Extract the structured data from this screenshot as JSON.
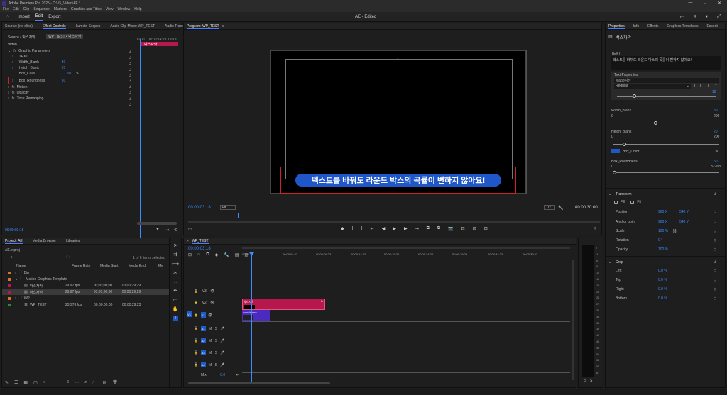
{
  "app": {
    "title": "Adobe Premiere Pro 2025 - D:\\15_Video\\AE *",
    "window_buttons": [
      "—",
      "□",
      "✕"
    ]
  },
  "menu": [
    "File",
    "Edit",
    "Clip",
    "Sequence",
    "Markers",
    "Graphics and Titles",
    "View",
    "Window",
    "Help"
  ],
  "workspace": {
    "tabs": [
      "Import",
      "Edit",
      "Export"
    ],
    "active": "Edit",
    "center_text": "AE - Edited"
  },
  "effect_controls": {
    "tabs": [
      "Source: (no clips)",
      "Effect Controls",
      "Lumetri Scopes",
      "Audio Clip Mixer: WP_TEST",
      "Audio Track Mix"
    ],
    "source_label": "Source • 박스자막",
    "sequence_label": "WP_TEST • 박스자막",
    "time_start": "00:00",
    "time_mid": "00:00:14:23",
    "time_end": "00:00",
    "clip_label": "박스자막",
    "video_header": "Video",
    "graphic_params": "Graphic Parameters",
    "params": [
      {
        "name": "TEXT",
        "value": ""
      },
      {
        "name": "Width_Blank",
        "value": "80"
      },
      {
        "name": "Heigh_Blank",
        "value": "20"
      },
      {
        "name": "Box_Color",
        "value": "001"
      },
      {
        "name": "Box_Roundness",
        "value": "50"
      }
    ],
    "sections": [
      "Motion",
      "Opacity",
      "Time Remapping"
    ],
    "fx": "fx",
    "timecode": "00:00:03:18"
  },
  "program": {
    "title": "Program: WP_TEST",
    "caption_text": "텍스트를 바꿔도 라운드 박스의 곡률이 변하지 않아요!",
    "timecode": "00:00:03:18",
    "zoom": "Fit",
    "quality": "1/2",
    "duration": "00:00:30:00",
    "transport": [
      "◆",
      "{",
      "}",
      "⇤",
      "◀",
      "▶",
      "▶",
      "⇥",
      "⧉",
      "⧉",
      "📷",
      "⊡",
      "⊡",
      "⊡",
      "+"
    ]
  },
  "project": {
    "tabs": [
      "Project: AE",
      "Media Browser",
      "Libraries"
    ],
    "file": "AE.prproj",
    "items_selected": "1 of 6 items selected",
    "columns": [
      "Name",
      "Frame Rate",
      "Media Start",
      "Media End",
      "Me"
    ],
    "rows": [
      {
        "name": "Bin",
        "fr": "",
        "start": "",
        "end": "",
        "color": "#d3782b"
      },
      {
        "name": "Motion Graphics Template",
        "fr": "",
        "start": "",
        "end": "",
        "color": "#d3782b"
      },
      {
        "name": "박스자막",
        "fr": "29.97 fps",
        "start": "00;00;00;00",
        "end": "00;00;29;29",
        "color": "#b6174d"
      },
      {
        "name": "박스자막",
        "fr": "29.97 fps",
        "start": "00;00;00;00",
        "end": "00;00;29;29",
        "color": "#b6174d"
      },
      {
        "name": "WP",
        "fr": "",
        "start": "",
        "end": "",
        "color": "#d3782b"
      },
      {
        "name": "WP_TEST",
        "fr": "23.976 fps",
        "start": "00:00:00:00",
        "end": "00:00:29:23",
        "color": "#2f8a2f"
      }
    ]
  },
  "timeline": {
    "tab": "WP_TEST",
    "timecode": "00:00:03:18",
    "ruler": [
      "00:00",
      "00:00:04:23",
      "00:00:09:23",
      "00:00:14:22",
      "00:00:19:22",
      "00:00:24:22",
      "00:00:29:23",
      "00:00:34:23",
      "00:00:39:23",
      "00:00:44:22",
      "00:00:49:21"
    ],
    "video_tracks": [
      "V3",
      "V2",
      "V1"
    ],
    "audio_tracks": [
      "A1",
      "A2",
      "A3",
      "A4"
    ],
    "mix_label": "Mix",
    "mix_value": "0.0",
    "clip_graphic": "박스자막",
    "clip_video": "wondahmo..."
  },
  "meter_scale": [
    "0",
    "-3",
    "-6",
    "-9",
    "-12",
    "-15",
    "-18",
    "-21",
    "-24",
    "-27",
    "-30",
    "-33",
    "-36",
    "-39",
    "-42",
    "-45",
    "-48",
    "-51",
    "-54",
    "-57",
    "dB"
  ],
  "properties": {
    "tabs": [
      "Properties",
      "Info",
      "Effects",
      "Graphics Templates",
      "Essent"
    ],
    "clip_name": "박스자막",
    "text_label": "TEXT",
    "text_value": "텍스트를 바꿔도 라운드 박스의 곡률이 변하지 않아요!",
    "text_props_label": "Text Properties",
    "font": "Mapo여전",
    "style": "Regular",
    "font_size": "18",
    "width_label": "Width_Blank",
    "width_min": "0",
    "width_max": "200",
    "width_value": "80",
    "heigh_label": "Heigh_Blank",
    "heigh_min": "0",
    "heigh_max": "200",
    "heigh_value": "20",
    "box_color_label": "Box_Color",
    "box_color": "#1f57c9",
    "round_label": "Box_Roundness",
    "round_min": "0",
    "round_max": "32768",
    "round_value": "50",
    "transform_label": "Transform",
    "fit": "Fill",
    "fit2": "Fit",
    "position_label": "Position",
    "position_x": "960 X",
    "position_y": "540 Y",
    "anchor_label": "Anchor point",
    "anchor_x": "960 X",
    "anchor_y": "540 Y",
    "scale_label": "Scale",
    "scale_value": "100 %",
    "rotation_label": "Rotation",
    "rotation_value": "0 °",
    "opacity_label": "Opacity",
    "opacity_value": "100 %",
    "crop_label": "Crop",
    "crop": [
      {
        "label": "Left",
        "value": "0.0 %"
      },
      {
        "label": "Top",
        "value": "0.0 %"
      },
      {
        "label": "Right",
        "value": "0.0 %"
      },
      {
        "label": "Bottom",
        "value": "0.0 %"
      }
    ]
  },
  "colors": {
    "accent": "#3c8cff",
    "selection": "#d11f2b",
    "pink_clip": "#b6174d",
    "purple_clip": "#4b2bbf"
  }
}
